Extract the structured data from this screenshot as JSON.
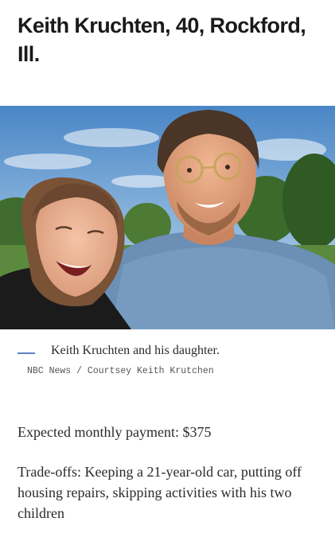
{
  "article": {
    "headline": "Keith Kruchten, 40, Rockford, Ill.",
    "photo_caption": "Keith Kruchten and his daughter.",
    "photo_credit": "NBC News / Courtsey Keith Krutchen",
    "paragraphs": [
      "Expected monthly payment: $375",
      "Trade-offs: Keeping a 21-year-old car, putting off housing repairs, skipping activities with his two children"
    ]
  }
}
